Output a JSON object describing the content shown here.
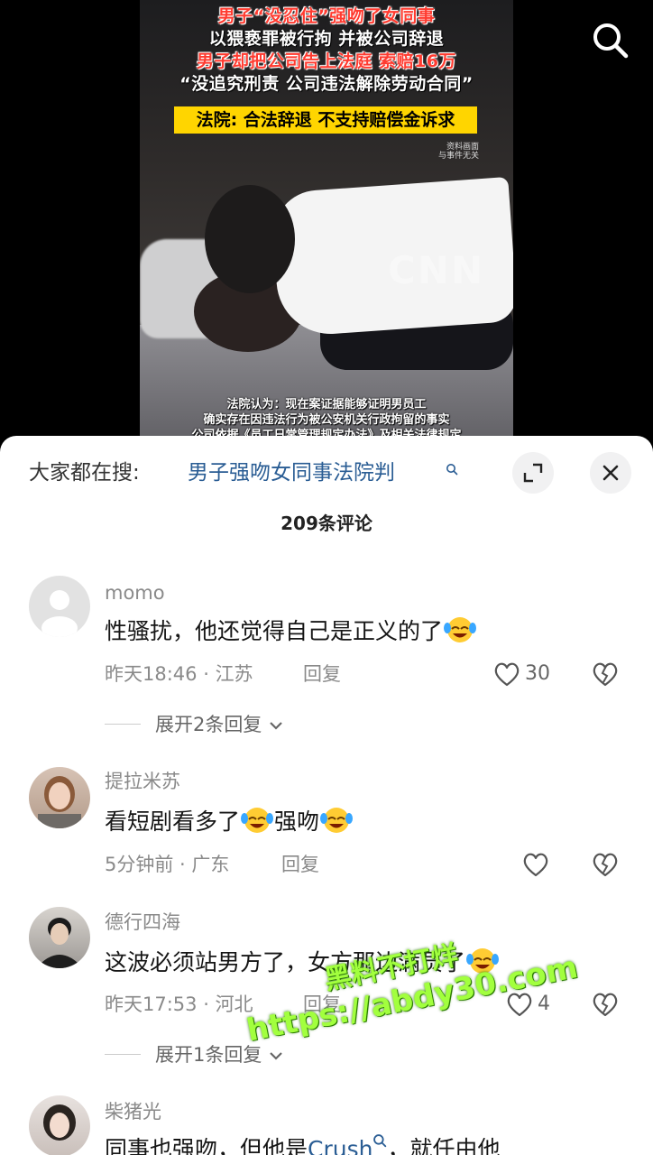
{
  "video": {
    "headline_lines": [
      {
        "text": "男子“没忍住”强吻了女同事",
        "color": "red"
      },
      {
        "text": "以猥亵罪被行拘 并被公司辞退",
        "color": "white"
      },
      {
        "text": "男子却把公司告上法庭 索赔16万",
        "color": "red"
      },
      {
        "text": "“没追究刑责 公司违法解除劳动合同”",
        "color": "white"
      }
    ],
    "court_line": "法院: 合法辞退 不支持赔偿金诉求",
    "source_note_1": "资料画面",
    "source_note_2": "与事件无关",
    "watermark": "CNN",
    "caption_1": "法院认为：现在案证据能够证明男员工",
    "caption_2": "确实存在因违法行为被公安机关行政拘留的事实",
    "caption_3": "公司依据《员工日常管理规定办法》及相关法律规定",
    "search_icon": "search-icon"
  },
  "sheet": {
    "search_prefix": "大家都在搜:",
    "search_term": "男子强吻女同事法院判",
    "expand_icon": "collapse-expand-icon",
    "close_icon": "close-icon",
    "comment_count": "209条评论"
  },
  "comments": [
    {
      "user": "momo",
      "text": "性骚扰，他还觉得自己是正义的了",
      "time": "昨天18:46",
      "location": "江苏",
      "reply": "回复",
      "likes": "30",
      "expand": "展开2条回复"
    },
    {
      "user": "提拉米苏",
      "text_a": "看短剧看多了",
      "text_b": "强吻",
      "time": "5分钟前",
      "location": "广东",
      "reply": "回复",
      "likes": ""
    },
    {
      "user": "德行四海",
      "text": "这波必须站男方了，女方那边满员了",
      "time": "昨天17:53",
      "location": "河北",
      "reply": "回复",
      "likes": "4",
      "expand": "展开1条回复"
    },
    {
      "user": "柴猪光",
      "text_a": "同事也强吻，但他是",
      "link": "Crush",
      "text_b": "，就任由他"
    }
  ],
  "overlay": {
    "promo_line_1": "黑料不打烊",
    "promo_line_2": "https://abdy30.com"
  },
  "colors": {
    "link": "#2a5d94",
    "headline_red": "#ff3b30",
    "court_box": "#ffd500",
    "promo_green": "#a2ff3e"
  }
}
